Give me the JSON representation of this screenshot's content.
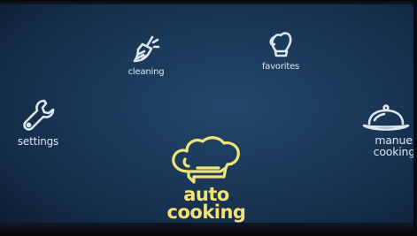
{
  "menu": {
    "cleaning": {
      "label": "cleaning",
      "icon": "broom-icon"
    },
    "favorites": {
      "label": "favorites",
      "icon": "oven-mitt-icon"
    },
    "settings": {
      "label": "settings",
      "icon": "wrench-icon"
    },
    "manual_cooking": {
      "line1": "manuel",
      "line2": "cooking",
      "icon": "cloche-icon"
    },
    "auto_cooking": {
      "line1": "auto",
      "line2": "cooking",
      "icon": "chef-hat-icon"
    }
  },
  "colors": {
    "background": "#1a3756",
    "label": "#dce6f0",
    "selected": "#f2e27a"
  }
}
